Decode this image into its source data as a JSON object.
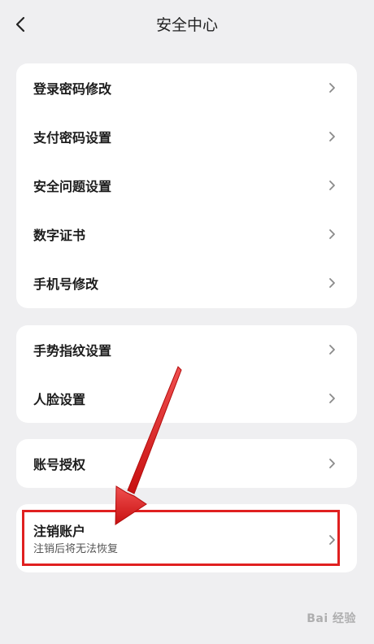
{
  "header": {
    "title": "安全中心",
    "back_icon": "chevron-left-icon"
  },
  "groups": [
    {
      "items": [
        {
          "label": "登录密码修改"
        },
        {
          "label": "支付密码设置"
        },
        {
          "label": "安全问题设置"
        },
        {
          "label": "数字证书"
        },
        {
          "label": "手机号修改"
        }
      ]
    },
    {
      "items": [
        {
          "label": "手势指纹设置"
        },
        {
          "label": "人脸设置"
        }
      ]
    },
    {
      "items": [
        {
          "label": "账号授权"
        }
      ]
    },
    {
      "items": [
        {
          "label": "注销账户",
          "sublabel": "注销后将无法恢复"
        }
      ]
    }
  ],
  "annotation": {
    "highlight_color": "#e02020",
    "arrow_color": "#e02020"
  },
  "watermark": "Bai 经验"
}
